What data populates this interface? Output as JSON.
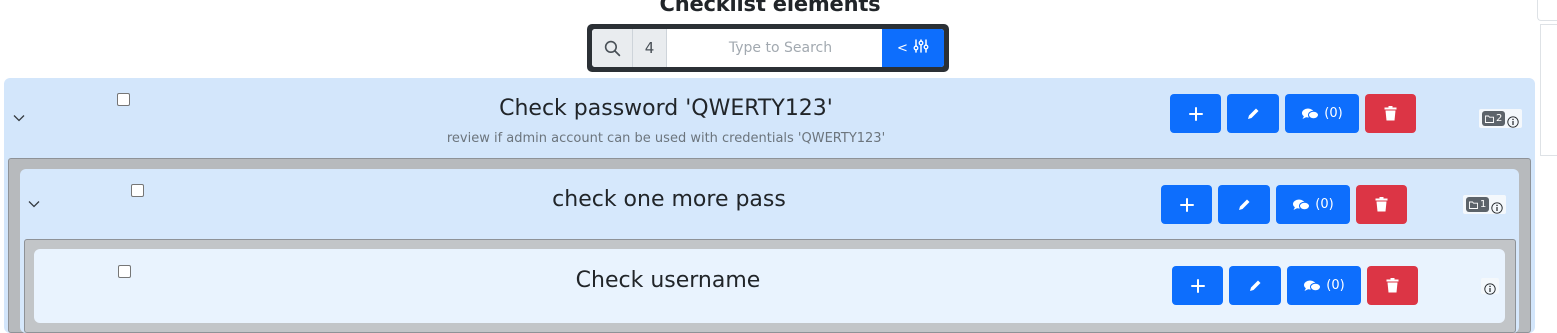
{
  "header": {
    "title": "Checklist elements"
  },
  "search": {
    "count": "4",
    "placeholder": "Type to Search",
    "filter_label": "<"
  },
  "colors": {
    "primary": "#0d6efd",
    "danger": "#dc3545",
    "row_bg": "#d3e6fb",
    "dark": "#2b3035"
  },
  "items": [
    {
      "title": "Check password 'QWERTY123'",
      "description": "review if admin account can be used with credentials 'QWERTY123'",
      "comments": "(0)",
      "children_count": "2"
    },
    {
      "title": "check one more pass",
      "description": "",
      "comments": "(0)",
      "children_count": "1"
    },
    {
      "title": "Check username",
      "description": "",
      "comments": "(0)",
      "children_count": ""
    }
  ]
}
